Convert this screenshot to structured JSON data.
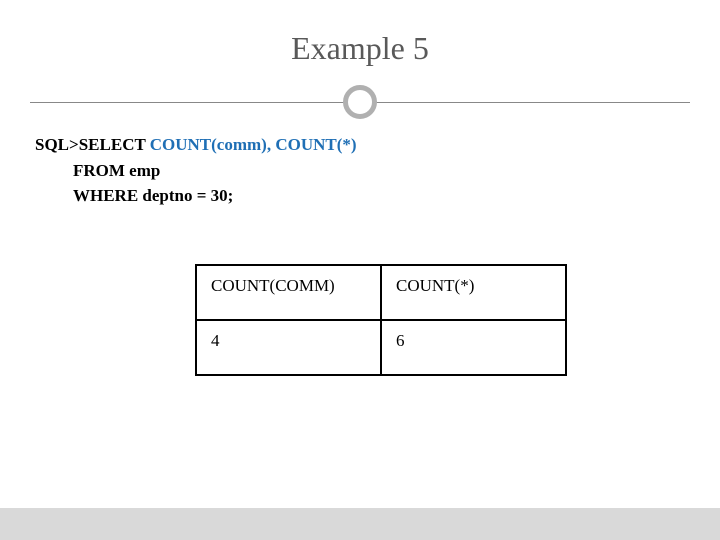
{
  "title": "Example 5",
  "query": {
    "prefix": "SQL>",
    "select_kw": "SELECT  ",
    "count_part": "COUNT(comm), COUNT(*)",
    "from_line": "FROM  emp",
    "where_line": "WHERE deptno = 30;"
  },
  "table": {
    "header": {
      "col1": "COUNT(COMM)",
      "col2": "COUNT(*)"
    },
    "row": {
      "col1": "4",
      "col2": "6"
    }
  }
}
